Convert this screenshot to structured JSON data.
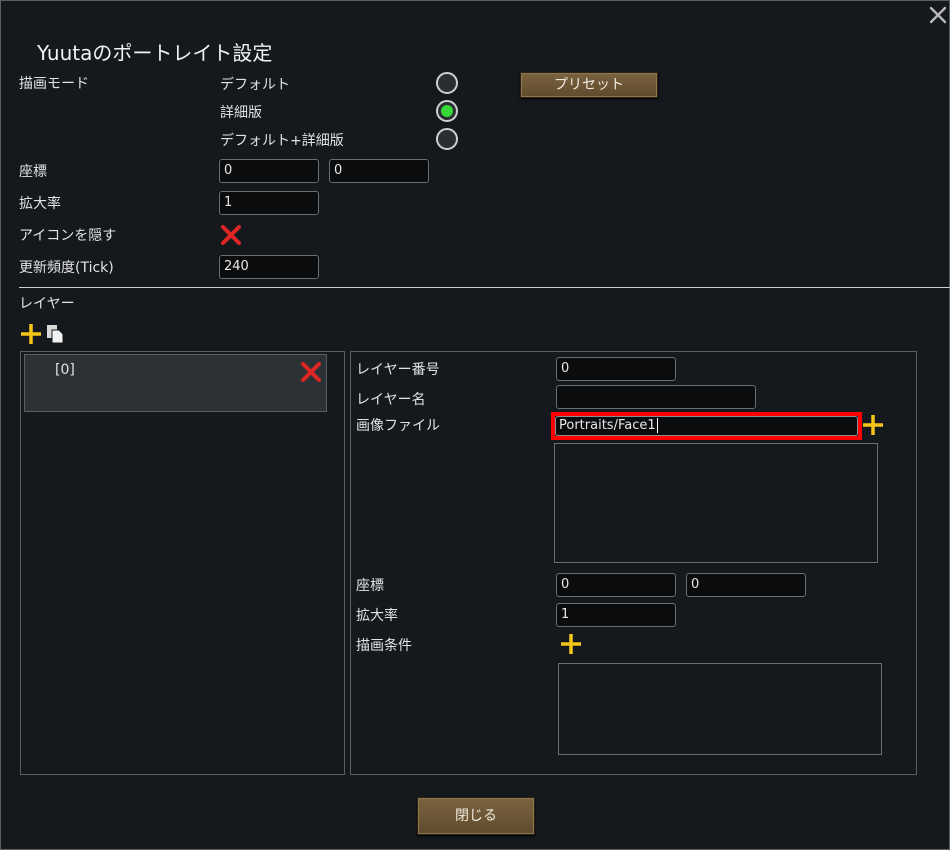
{
  "dialog": {
    "title": "Yuutaのポートレイト設定",
    "close_icon": "close-icon"
  },
  "render_mode": {
    "label": "描画モード",
    "options": [
      {
        "label": "デフォルト",
        "selected": false
      },
      {
        "label": "詳細版",
        "selected": true
      },
      {
        "label": "デフォルト+詳細版",
        "selected": false
      }
    ],
    "preset_button": "プリセット"
  },
  "coords": {
    "label": "座標",
    "x": "0",
    "y": "0"
  },
  "scale": {
    "label": "拡大率",
    "value": "1"
  },
  "hide_icon": {
    "label": "アイコンを隠す",
    "icon": "red-x-icon"
  },
  "update_freq": {
    "label": "更新頻度(Tick)",
    "value": "240"
  },
  "layers": {
    "label": "レイヤー",
    "add_icon": "plus-icon",
    "copy_icon": "copy-icon",
    "items": [
      {
        "label": "[0]"
      }
    ]
  },
  "layer_detail": {
    "number_label": "レイヤー番号",
    "number_value": "0",
    "name_label": "レイヤー名",
    "name_value": "",
    "image_label": "画像ファイル",
    "image_value": "Portraits/Face1",
    "coords_label": "座標",
    "coord_x": "0",
    "coord_y": "0",
    "scale_label": "拡大率",
    "scale_value": "1",
    "condition_label": "描画条件"
  },
  "colors": {
    "background": "#15191d",
    "accent_green": "#37d737",
    "button_brown": "#6b5535",
    "highlight_red": "#ff0000",
    "plus_yellow": "#f5c518",
    "x_red": "#e02525"
  },
  "footer": {
    "close_button": "閉じる"
  }
}
